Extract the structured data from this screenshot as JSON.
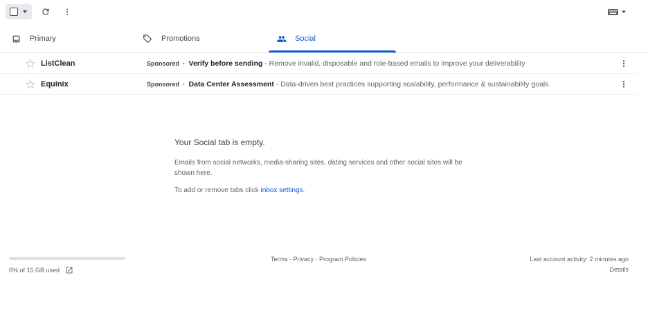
{
  "toolbar": {
    "select_icon": "checkbox-icon",
    "refresh_icon": "refresh-icon",
    "more_icon": "more-vert-icon",
    "input_tools_icon": "keyboard-icon"
  },
  "tabs": [
    {
      "label": "Primary",
      "icon": "inbox-icon",
      "active": false
    },
    {
      "label": "Promotions",
      "icon": "tag-icon",
      "active": false
    },
    {
      "label": "Social",
      "icon": "people-icon",
      "active": true
    }
  ],
  "emails": [
    {
      "sender": "ListClean",
      "badge": "Sponsored",
      "separator": "·",
      "subject": "Verify before sending",
      "snippet": " - Remove invalid, disposable and role-based emails to improve your deliverability"
    },
    {
      "sender": "Equinix",
      "badge": "Sponsored",
      "separator": "·",
      "subject": "Data Center Assessment",
      "snippet": " - Data-driven best practices supporting scalability, performance & sustainability goals."
    }
  ],
  "empty_state": {
    "title": "Your Social tab is empty.",
    "description": "Emails from social networks, media-sharing sites, dating services and other social sites will be shown here.",
    "settings_prefix": "To add or remove tabs click ",
    "settings_link": "inbox settings",
    "settings_suffix": "."
  },
  "footer": {
    "storage_used_fraction": 0,
    "storage_text": "0% of 15 GB used",
    "links": [
      "Terms",
      "Privacy",
      "Program Policies"
    ],
    "link_separator": " · ",
    "activity": "Last account activity: 2 minutes ago",
    "details": "Details"
  },
  "colors": {
    "accent": "#0b57d0",
    "text": "#202124",
    "muted": "#5f6368"
  }
}
